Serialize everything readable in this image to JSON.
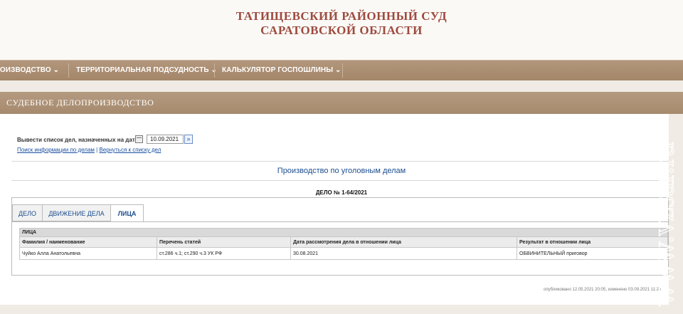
{
  "header": {
    "line1": "ТАТИЩЕВСКИЙ РАЙОННЫЙ СУД",
    "line2": "САРАТОВСКОЙ ОБЛАСТИ"
  },
  "nav": [
    "ПРОИЗВОДСТВО ⌄",
    "ТЕРРИТОРИАЛЬНАЯ ПОДСУДНОСТЬ ⌄",
    "КАЛЬКУЛЯТОР ГОСПОШЛИНЫ ⌄"
  ],
  "section": {
    "title": "СУДЕБНОЕ ДЕЛОПРОИЗВОДСТВО"
  },
  "filter": {
    "label": "Вывести список дел, назначенных на дату",
    "date": "10.09.2021",
    "go": "»"
  },
  "links": {
    "search": "Поиск информации по делам",
    "separator": "|",
    "back": "Вернуться к списку дел"
  },
  "page": {
    "title": "Производство по уголовным делам",
    "case": "ДЕЛО № 1-64/2021"
  },
  "tabs": [
    "ДЕЛО",
    "ДВИЖЕНИЕ ДЕЛА",
    "ЛИЦА"
  ],
  "persons": {
    "group": "ЛИЦА",
    "columns": [
      "Фамилия / наименование",
      "Перечень статей",
      "Дата рассмотрения дела в отношении лица",
      "Результат в отношении лица"
    ],
    "rows": [
      [
        "Чуйко Алла Анатольевна",
        "ст.286 ч.1; ст.290 ч.3 УК РФ",
        "30.08.2021",
        "ОБВИНИТЕЛЬНЫЙ приговор"
      ]
    ]
  },
  "footer": {
    "note": "опубликовано 12.05.2021 20:05, изменено 03.09.2021 11:20"
  },
  "watermark": "www.vzsar.ru"
}
